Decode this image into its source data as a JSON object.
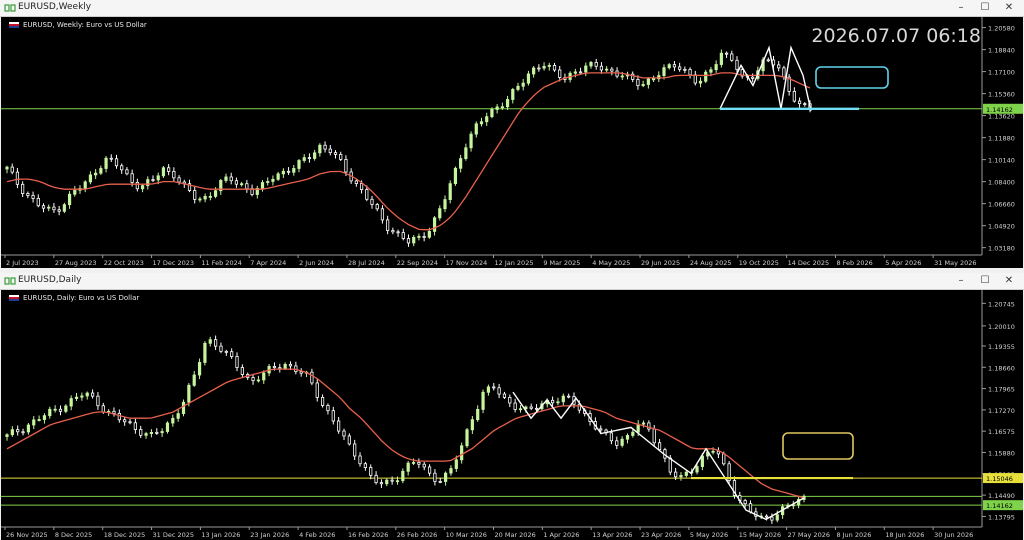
{
  "windows": [
    {
      "title": "EURUSD,Weekly",
      "symbol_label": "EURUSD, Weekly:  Euro vs US Dollar",
      "clock": "2026.07.07 06:18",
      "price_axis": [
        "1.20580",
        "1.18840",
        "1.17100",
        "1.15360",
        "1.13620",
        "1.11880",
        "1.10140",
        "1.08400",
        "1.06660",
        "1.04920",
        "1.03180"
      ],
      "price_badge": "1.14162",
      "time_axis": [
        "2 Jul 2023",
        "27 Aug 2023",
        "22 Oct 2023",
        "17 Dec 2023",
        "11 Feb 2024",
        "7 Apr 2024",
        "2 Jun 2024",
        "28 Jul 2024",
        "22 Sep 2024",
        "17 Nov 2024",
        "12 Jan 2025",
        "9 Mar 2025",
        "4 May 2025",
        "29 Jun 2025",
        "24 Aug 2025",
        "19 Oct 2025",
        "14 Dec 2025",
        "8 Feb 2026",
        "5 Apr 2026",
        "31 May 2026"
      ]
    },
    {
      "title": "EURUSD,Daily",
      "symbol_label": "EURUSD, Daily:  Euro vs US Dollar",
      "price_axis": [
        "1.20745",
        "1.20010",
        "1.19355",
        "1.18660",
        "1.17965",
        "1.17270",
        "1.16575",
        "1.15880",
        "1.15185",
        "1.14490",
        "1.13795"
      ],
      "price_badges": [
        "1.15046",
        "1.14162"
      ],
      "time_axis": [
        "26 Nov 2025",
        "8 Dec 2025",
        "18 Dec 2025",
        "31 Dec 2025",
        "13 Jan 2026",
        "23 Jan 2026",
        "4 Feb 2026",
        "16 Feb 2026",
        "26 Feb 2026",
        "10 Mar 2026",
        "20 Mar 2026",
        "1 Apr 2026",
        "13 Apr 2026",
        "23 Apr 2026",
        "5 May 2026",
        "15 May 2026",
        "27 May 2026",
        "8 Jun 2026",
        "18 Jun 2026",
        "30 Jun 2026"
      ]
    }
  ],
  "window_buttons": {
    "minimize": "–",
    "maximize": "☐",
    "close": "✕"
  },
  "colors": {
    "bull": "#c6f5a0",
    "bear": "#ffffff",
    "ma": "#e8604c",
    "hline_green": "#7fd34a",
    "hline_yellow": "#e8e03a",
    "box_cyan": "#5fd3ea",
    "box_yellow": "#e0c860",
    "pattern": "#ffffff",
    "neckline_cyan": "#6fe0f5"
  },
  "chart_data": [
    {
      "type": "candlestick",
      "title": "EURUSD, Weekly:  Euro vs US Dollar",
      "ylim": [
        1.026,
        1.211
      ],
      "horizontal_lines": [
        1.1416
      ],
      "pattern_points_close": [
        1.1416,
        1.176,
        1.16,
        1.19,
        1.1416,
        1.19,
        1.168,
        1.14
      ],
      "close_path": [
        1.094,
        1.082,
        1.072,
        1.064,
        1.06,
        1.066,
        1.076,
        1.082,
        1.094,
        1.102,
        1.096,
        1.086,
        1.08,
        1.084,
        1.094,
        1.09,
        1.078,
        1.07,
        1.072,
        1.082,
        1.086,
        1.082,
        1.076,
        1.08,
        1.09,
        1.092,
        1.096,
        1.104,
        1.112,
        1.108,
        1.098,
        1.086,
        1.074,
        1.062,
        1.05,
        1.042,
        1.036,
        1.04,
        1.048,
        1.064,
        1.088,
        1.112,
        1.126,
        1.136,
        1.144,
        1.15,
        1.16,
        1.172,
        1.178,
        1.17,
        1.166,
        1.172,
        1.174,
        1.176,
        1.172,
        1.168,
        1.164,
        1.162,
        1.166,
        1.172,
        1.178,
        1.17,
        1.16,
        1.172,
        1.186,
        1.18,
        1.164,
        1.17,
        1.18,
        1.176,
        1.16,
        1.144,
        1.142
      ],
      "ma_path": [
        1.084,
        1.086,
        1.086,
        1.084,
        1.08,
        1.078,
        1.078,
        1.078,
        1.08,
        1.082,
        1.082,
        1.082,
        1.082,
        1.082,
        1.084,
        1.084,
        1.082,
        1.08,
        1.078,
        1.078,
        1.078,
        1.078,
        1.078,
        1.078,
        1.08,
        1.082,
        1.084,
        1.086,
        1.09,
        1.092,
        1.092,
        1.088,
        1.082,
        1.074,
        1.064,
        1.056,
        1.05,
        1.046,
        1.046,
        1.05,
        1.058,
        1.07,
        1.084,
        1.098,
        1.112,
        1.126,
        1.14,
        1.15,
        1.158,
        1.162,
        1.166,
        1.168,
        1.17,
        1.17,
        1.17,
        1.17,
        1.168,
        1.166,
        1.166,
        1.166,
        1.168,
        1.168,
        1.168,
        1.168,
        1.17,
        1.17,
        1.168,
        1.168,
        1.168,
        1.168,
        1.166,
        1.162,
        1.158
      ]
    },
    {
      "type": "candlestick",
      "title": "EURUSD, Daily:  Euro vs US Dollar",
      "ylim": [
        1.1345,
        1.2105
      ],
      "horizontal_lines": [
        1.15046,
        1.1445,
        1.14162
      ],
      "close_path": [
        1.164,
        1.166,
        1.168,
        1.17,
        1.172,
        1.174,
        1.176,
        1.178,
        1.176,
        1.172,
        1.17,
        1.168,
        1.166,
        1.164,
        1.166,
        1.17,
        1.176,
        1.184,
        1.196,
        1.194,
        1.19,
        1.186,
        1.182,
        1.184,
        1.186,
        1.188,
        1.186,
        1.184,
        1.178,
        1.172,
        1.166,
        1.16,
        1.156,
        1.15,
        1.148,
        1.15,
        1.154,
        1.156,
        1.152,
        1.15,
        1.152,
        1.16,
        1.17,
        1.178,
        1.18,
        1.176,
        1.174,
        1.172,
        1.174,
        1.176,
        1.176,
        1.176,
        1.172,
        1.168,
        1.164,
        1.162,
        1.164,
        1.168,
        1.166,
        1.16,
        1.152,
        1.15,
        1.154,
        1.158,
        1.16,
        1.152,
        1.144,
        1.14,
        1.137,
        1.138,
        1.14,
        1.142,
        1.144
      ],
      "ma_path": [
        1.16,
        1.162,
        1.164,
        1.166,
        1.168,
        1.169,
        1.17,
        1.171,
        1.172,
        1.172,
        1.171,
        1.17,
        1.17,
        1.17,
        1.171,
        1.172,
        1.174,
        1.176,
        1.178,
        1.18,
        1.182,
        1.183,
        1.184,
        1.185,
        1.186,
        1.186,
        1.186,
        1.185,
        1.183,
        1.18,
        1.177,
        1.173,
        1.17,
        1.166,
        1.162,
        1.159,
        1.157,
        1.156,
        1.156,
        1.156,
        1.156,
        1.158,
        1.16,
        1.163,
        1.166,
        1.168,
        1.17,
        1.171,
        1.172,
        1.173,
        1.174,
        1.174,
        1.174,
        1.173,
        1.172,
        1.17,
        1.169,
        1.168,
        1.167,
        1.166,
        1.164,
        1.162,
        1.16,
        1.16,
        1.16,
        1.158,
        1.155,
        1.152,
        1.149,
        1.147,
        1.146,
        1.145,
        1.144
      ],
      "pattern_points_close": [
        1.1785,
        1.17,
        1.176,
        1.17,
        1.1765,
        1.165,
        1.167,
        1.158,
        1.152,
        1.16,
        1.14,
        1.137,
        1.144
      ]
    }
  ]
}
